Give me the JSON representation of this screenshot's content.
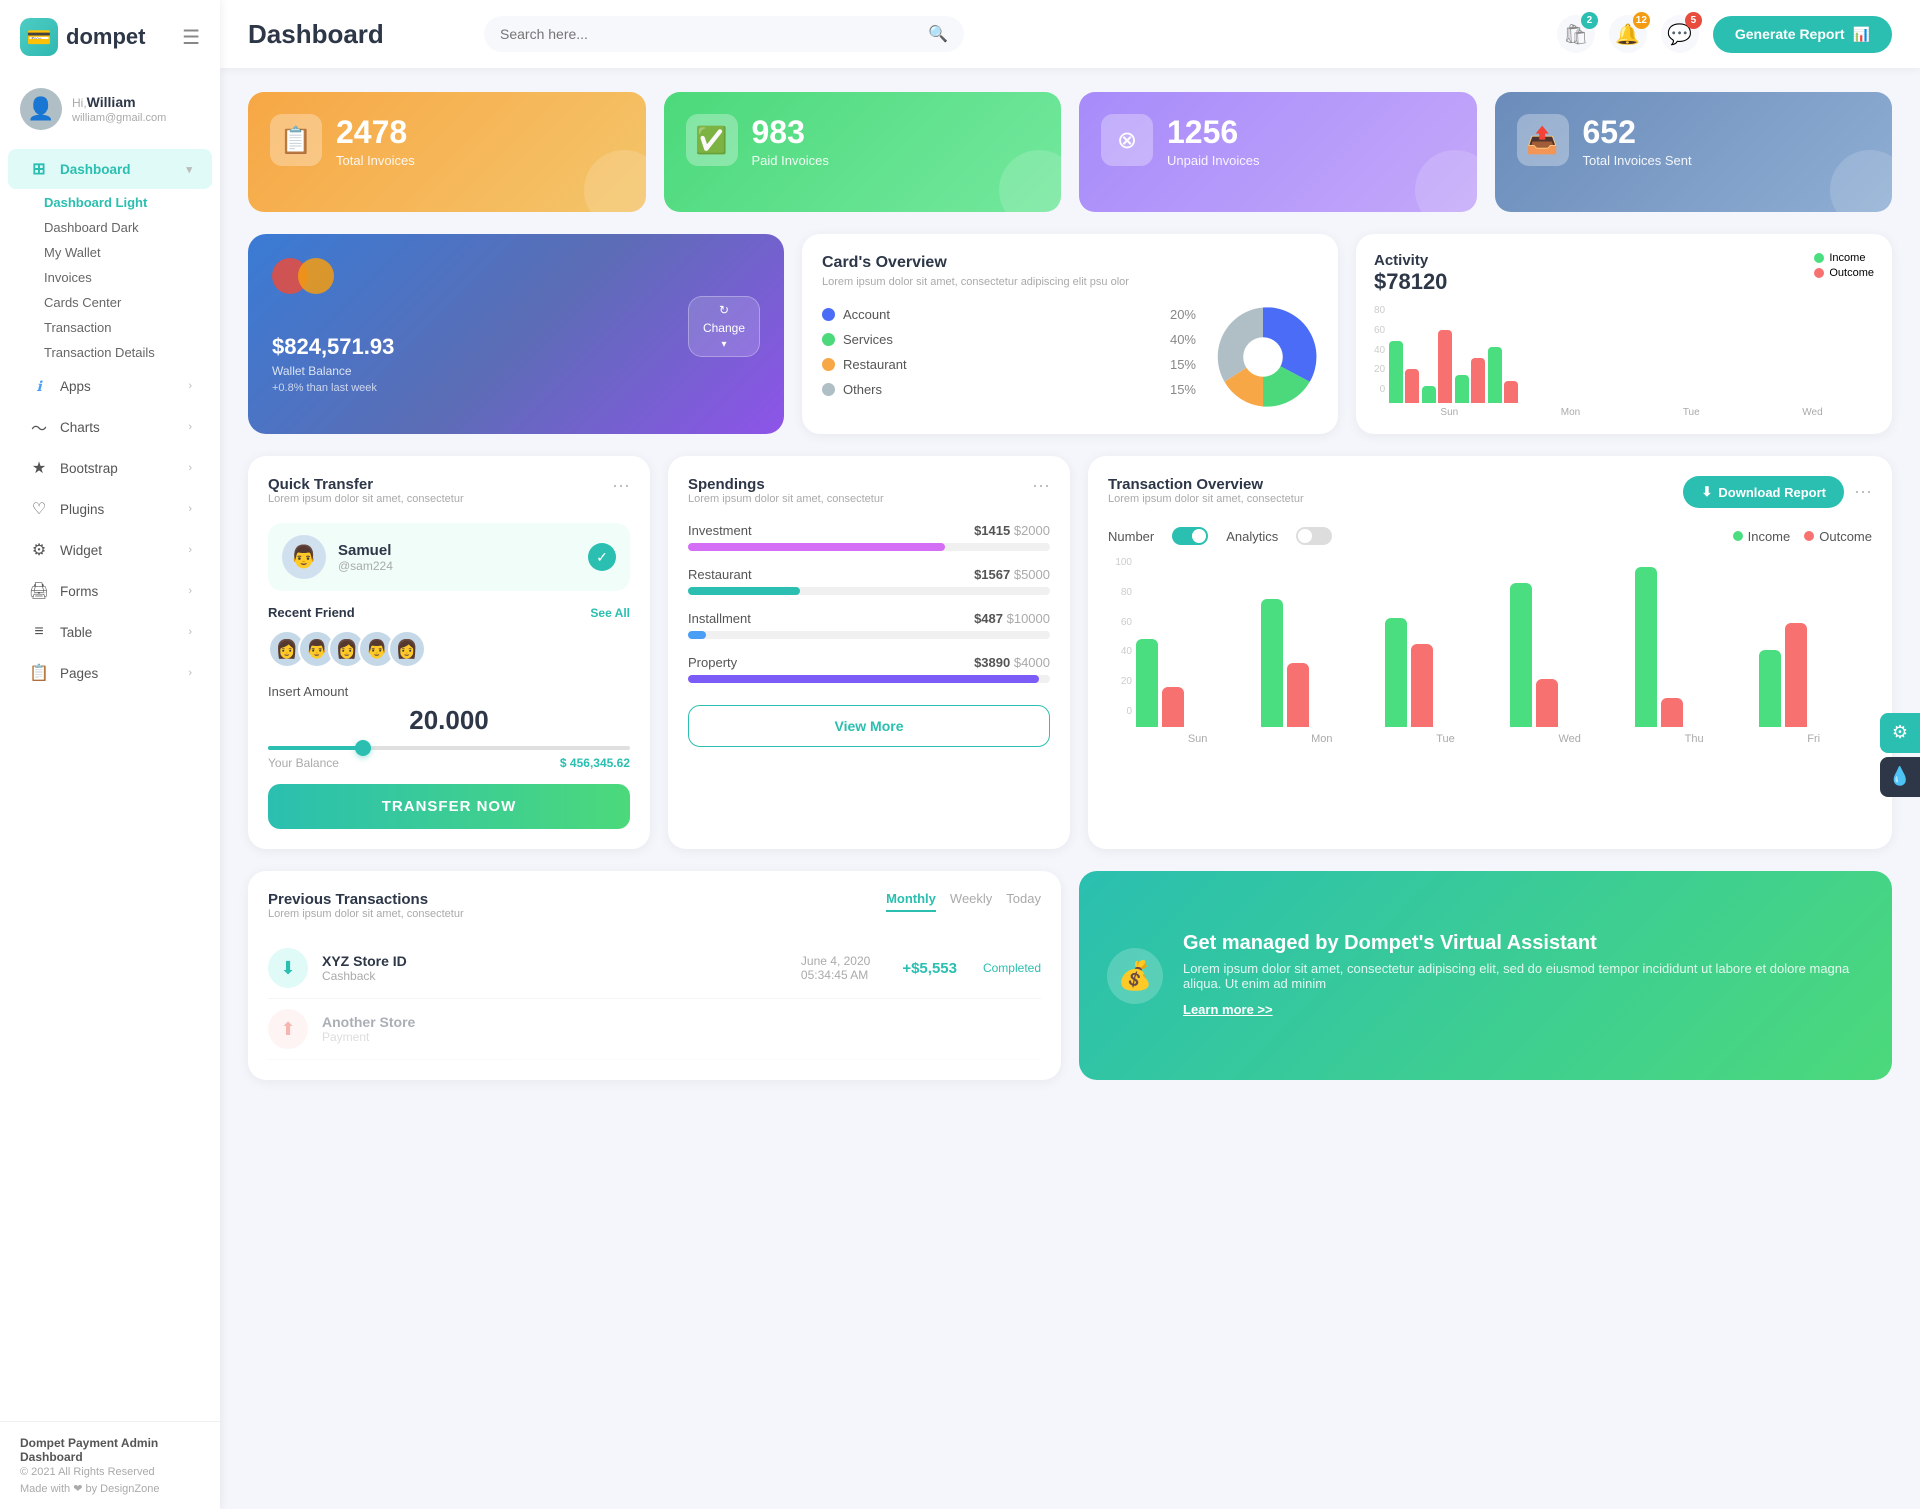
{
  "app": {
    "name": "dompet",
    "logo_icon": "💳",
    "copyright": "Dompet Payment Admin Dashboard",
    "year": "© 2021 All Rights Reserved",
    "made_with": "Made with ❤ by DesignZone"
  },
  "user": {
    "greeting": "Hi,",
    "name": "William",
    "email": "william@gmail.com"
  },
  "header": {
    "title": "Dashboard",
    "search_placeholder": "Search here...",
    "generate_btn": "Generate Report",
    "notifications": {
      "bell": "12",
      "message": "5",
      "bag": "2"
    }
  },
  "sidebar": {
    "nav_items": [
      {
        "id": "dashboard",
        "label": "Dashboard",
        "icon": "⊞",
        "active": true,
        "arrow": "▾"
      },
      {
        "id": "apps",
        "label": "Apps",
        "icon": "ℹ",
        "arrow": "›"
      },
      {
        "id": "charts",
        "label": "Charts",
        "icon": "📈",
        "arrow": "›"
      },
      {
        "id": "bootstrap",
        "label": "Bootstrap",
        "icon": "★",
        "arrow": "›"
      },
      {
        "id": "plugins",
        "label": "Plugins",
        "icon": "♡",
        "arrow": "›"
      },
      {
        "id": "widget",
        "label": "Widget",
        "icon": "⚙",
        "arrow": "›"
      },
      {
        "id": "forms",
        "label": "Forms",
        "icon": "🖨",
        "arrow": "›"
      },
      {
        "id": "table",
        "label": "Table",
        "icon": "≡",
        "arrow": "›"
      },
      {
        "id": "pages",
        "label": "Pages",
        "icon": "📋",
        "arrow": "›"
      }
    ],
    "sub_items": [
      {
        "label": "Dashboard Light",
        "active": true
      },
      {
        "label": "Dashboard Dark",
        "active": false
      },
      {
        "label": "My Wallet",
        "active": false
      },
      {
        "label": "Invoices",
        "active": false
      },
      {
        "label": "Cards Center",
        "active": false
      },
      {
        "label": "Transaction",
        "active": false
      },
      {
        "label": "Transaction Details",
        "active": false
      }
    ]
  },
  "stat_cards": [
    {
      "id": "total",
      "number": "2478",
      "label": "Total Invoices",
      "color": "orange",
      "icon": "📋"
    },
    {
      "id": "paid",
      "number": "983",
      "label": "Paid Invoices",
      "color": "green",
      "icon": "✔"
    },
    {
      "id": "unpaid",
      "number": "1256",
      "label": "Unpaid Invoices",
      "color": "purple",
      "icon": "✕"
    },
    {
      "id": "sent",
      "number": "652",
      "label": "Total Invoices Sent",
      "color": "blue-gray",
      "icon": "📤"
    }
  ],
  "wallet": {
    "amount": "$824,571.93",
    "label": "Wallet Balance",
    "change": "+0.8% than last week",
    "change_btn": "Change"
  },
  "cards_overview": {
    "title": "Card's Overview",
    "subtitle": "Lorem ipsum dolor sit amet, consectetur adipiscing elit psu olor",
    "items": [
      {
        "label": "Account",
        "pct": "20%",
        "color": "#4a6cf7"
      },
      {
        "label": "Services",
        "pct": "40%",
        "color": "#4cd97b"
      },
      {
        "label": "Restaurant",
        "pct": "15%",
        "color": "#f7a745"
      },
      {
        "label": "Others",
        "pct": "15%",
        "color": "#b0bec5"
      }
    ]
  },
  "activity": {
    "title": "Activity",
    "amount": "$78120",
    "income_label": "Income",
    "outcome_label": "Outcome",
    "bars": [
      {
        "day": "Sun",
        "income": 55,
        "outcome": 30
      },
      {
        "day": "Mon",
        "income": 15,
        "outcome": 65
      },
      {
        "day": "Tue",
        "income": 25,
        "outcome": 40
      },
      {
        "day": "Wed",
        "income": 50,
        "outcome": 20
      }
    ],
    "y_labels": [
      "80",
      "60",
      "40",
      "20",
      "0"
    ]
  },
  "quick_transfer": {
    "title": "Quick Transfer",
    "subtitle": "Lorem ipsum dolor sit amet, consectetur",
    "person": {
      "name": "Samuel",
      "handle": "@sam224"
    },
    "recent_friends_label": "Recent Friend",
    "see_all": "See All",
    "insert_amount_label": "Insert Amount",
    "amount": "20.000",
    "balance_label": "Your Balance",
    "balance_value": "$ 456,345.62",
    "transfer_btn": "TRANSFER NOW"
  },
  "spendings": {
    "title": "Spendings",
    "subtitle": "Lorem ipsum dolor sit amet, consectetur",
    "items": [
      {
        "label": "Investment",
        "current": "$1415",
        "max": "$2000",
        "pct": 71,
        "color": "#d46ef5"
      },
      {
        "label": "Restaurant",
        "current": "$1567",
        "max": "$5000",
        "pct": 31,
        "color": "#2abfb0"
      },
      {
        "label": "Installment",
        "current": "$487",
        "max": "$10000",
        "pct": 5,
        "color": "#4a9ef5"
      },
      {
        "label": "Property",
        "current": "$3890",
        "max": "$4000",
        "pct": 97,
        "color": "#7c5cf7"
      }
    ],
    "view_more": "View More"
  },
  "transaction_overview": {
    "title": "Transaction Overview",
    "subtitle": "Lorem ipsum dolor sit amet, consectetur",
    "download_btn": "Download Report",
    "number_label": "Number",
    "analytics_label": "Analytics",
    "income_label": "Income",
    "outcome_label": "Outcome",
    "bars": [
      {
        "day": "Sun",
        "income": 55,
        "outcome": 25
      },
      {
        "day": "Mon",
        "income": 80,
        "outcome": 40
      },
      {
        "day": "Tue",
        "income": 68,
        "outcome": 52
      },
      {
        "day": "Wed",
        "income": 90,
        "outcome": 30
      },
      {
        "day": "Thu",
        "income": 100,
        "outcome": 18
      },
      {
        "day": "Fri",
        "income": 48,
        "outcome": 65
      }
    ],
    "y_labels": [
      "100",
      "80",
      "60",
      "40",
      "20",
      "0"
    ]
  },
  "previous_transactions": {
    "title": "Previous Transactions",
    "subtitle": "Lorem ipsum dolor sit amet, consectetur",
    "tabs": [
      "Monthly",
      "Weekly",
      "Today"
    ],
    "active_tab": "Monthly",
    "items": [
      {
        "icon": "⬇",
        "icon_color": "green",
        "name": "XYZ Store ID",
        "type": "Cashback",
        "date": "June 4, 2020",
        "time": "05:34:45 AM",
        "amount": "+$5,553",
        "positive": true,
        "status": "Completed"
      }
    ]
  },
  "virtual_assistant": {
    "icon": "💰",
    "title": "Get managed by Dompet's Virtual Assistant",
    "subtitle": "Lorem ipsum dolor sit amet, consectetur adipiscing elit, sed do eiusmod tempor incididunt ut labore et dolore magna aliqua. Ut enim ad minim",
    "link": "Learn more >>"
  },
  "colors": {
    "primary": "#2abfb0",
    "income": "#4ade80",
    "outcome": "#f87171",
    "orange": "#f7a745",
    "purple": "#a78bfa",
    "blue": "#4a6cf7"
  }
}
